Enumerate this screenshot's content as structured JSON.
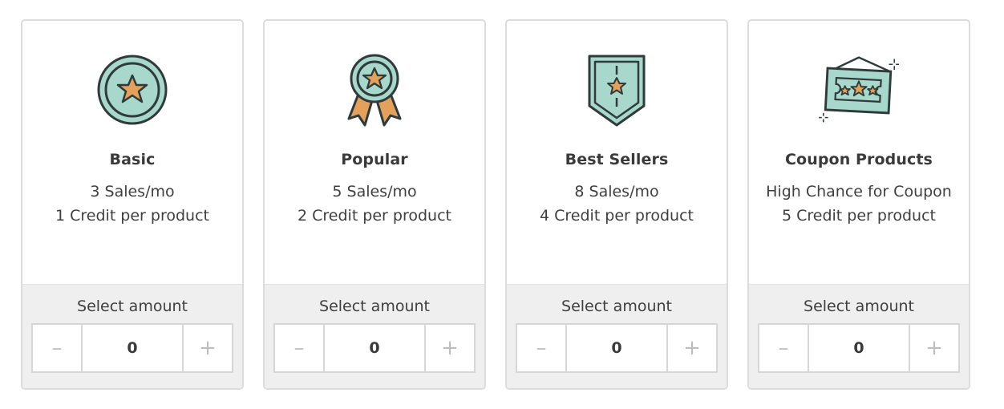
{
  "colors": {
    "mint": "#a8d8cc",
    "orange": "#e3a15c",
    "outline": "#2f3b3b"
  },
  "stepper": {
    "minus_symbol": "–",
    "plus_symbol": "+"
  },
  "cards": [
    {
      "icon": "medal-icon",
      "title": "Basic",
      "line1": "3 Sales/mo",
      "line2": "1 Credit per product",
      "select_label": "Select amount",
      "amount": "0"
    },
    {
      "icon": "ribbon-award-icon",
      "title": "Popular",
      "line1": "5 Sales/mo",
      "line2": "2 Credit per product",
      "select_label": "Select amount",
      "amount": "0"
    },
    {
      "icon": "shield-star-icon",
      "title": "Best Sellers",
      "line1": "8 Sales/mo",
      "line2": "4 Credit per product",
      "select_label": "Select amount",
      "amount": "0"
    },
    {
      "icon": "coupon-sign-icon",
      "title": "Coupon Products",
      "line1": "High Chance for Coupon",
      "line2": "5 Credit per product",
      "select_label": "Select amount",
      "amount": "0"
    }
  ]
}
